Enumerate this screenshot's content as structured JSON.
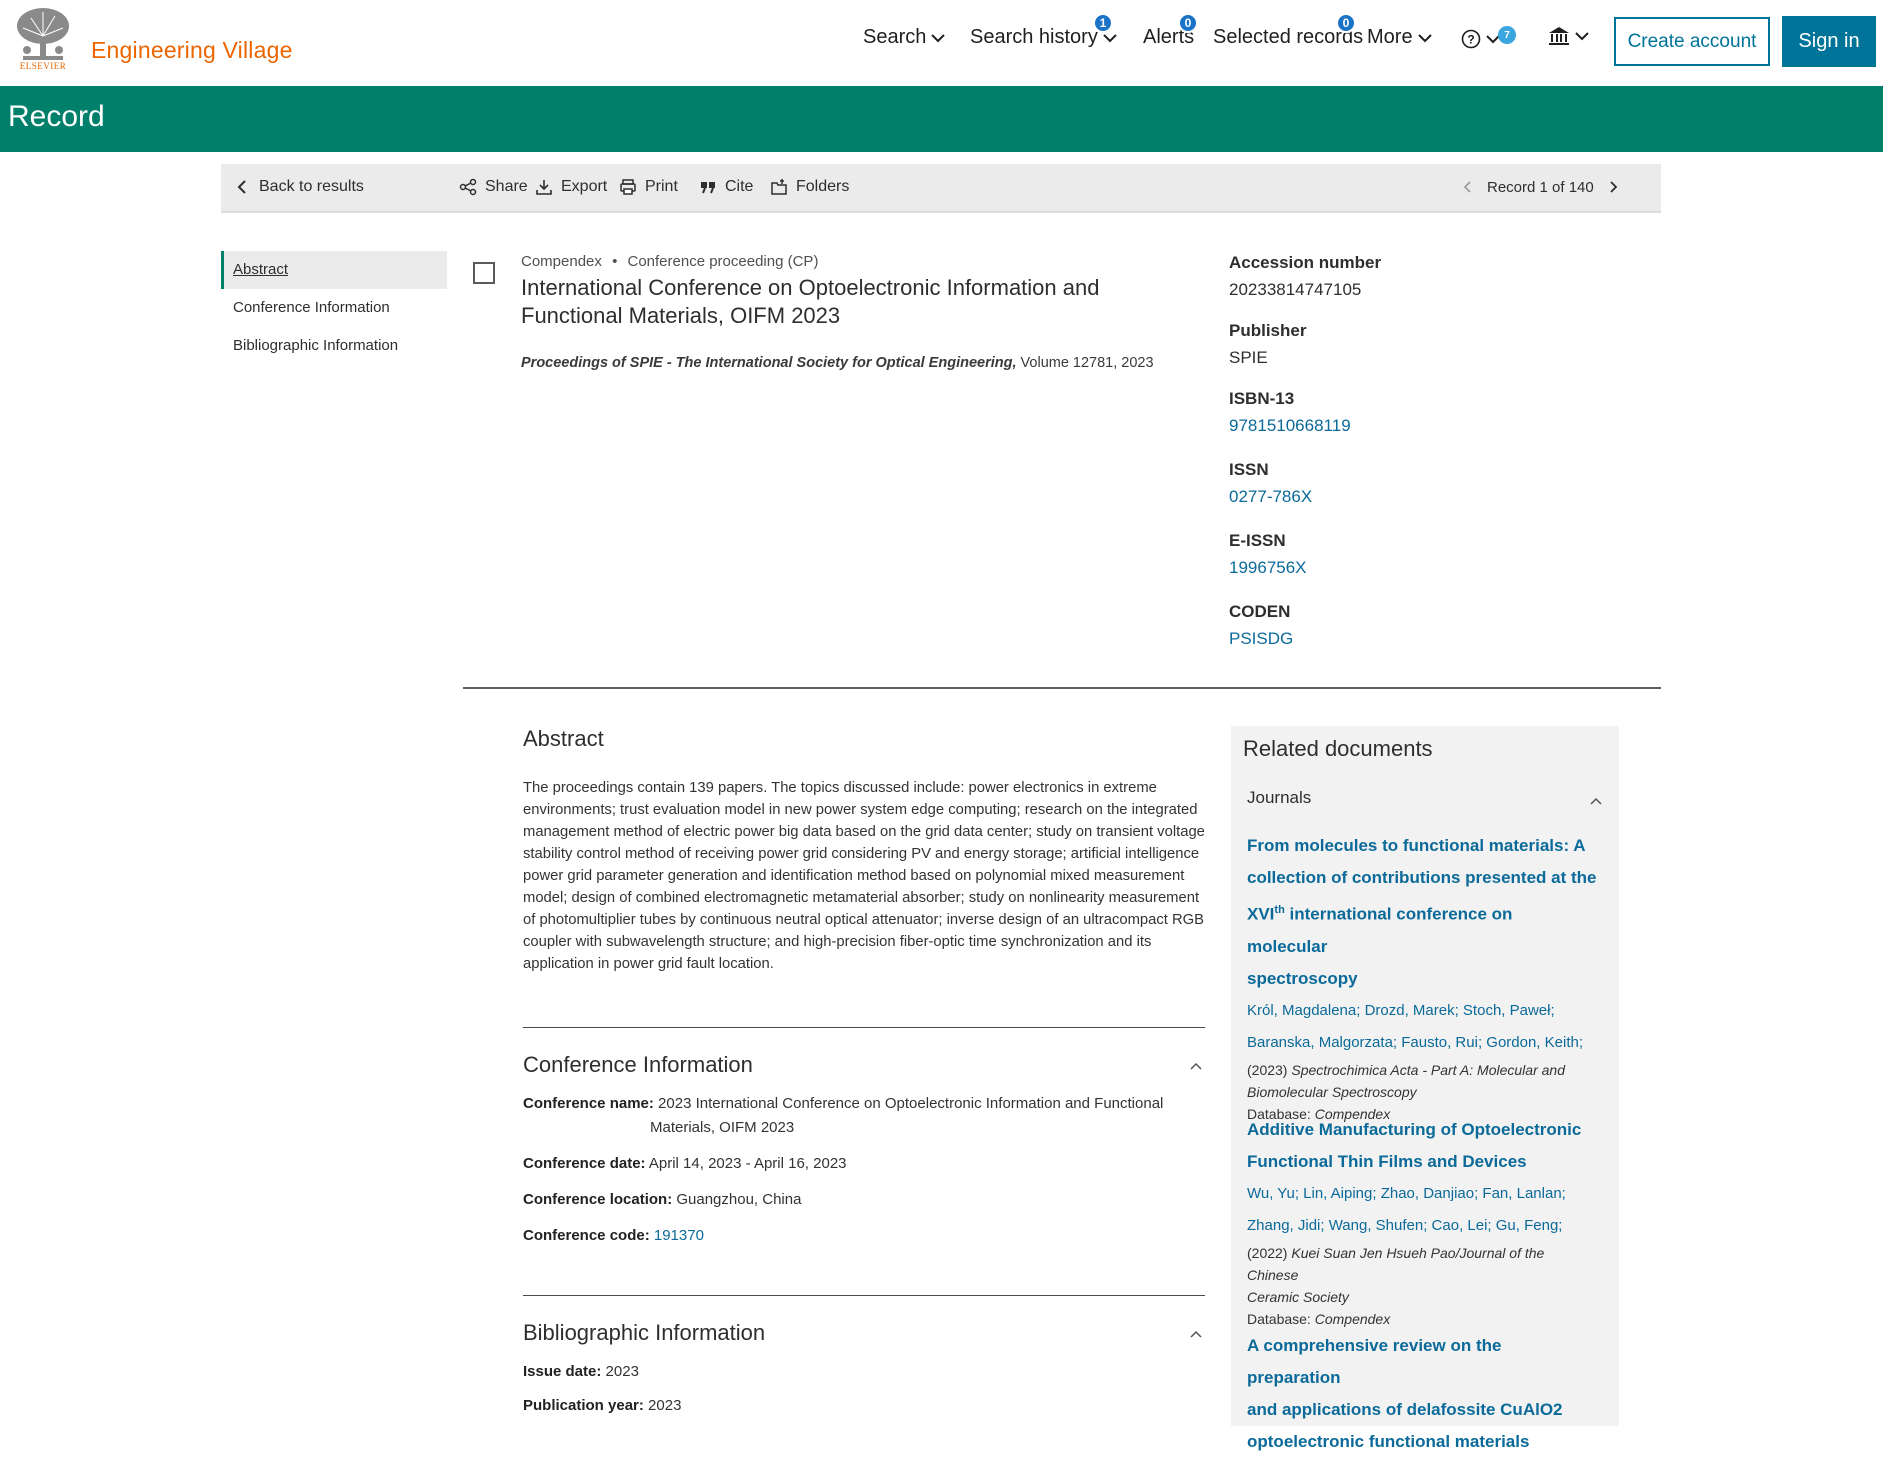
{
  "header": {
    "logo_text": "ELSEVIER",
    "brand": "Engineering Village",
    "nav": {
      "search": "Search",
      "search_history": "Search history",
      "search_history_badge": "1",
      "alerts": "Alerts",
      "alerts_badge": "0",
      "selected_records": "Selected records",
      "selected_records_badge": "0",
      "more": "More",
      "help_badge": "7"
    },
    "create_account": "Create account",
    "sign_in": "Sign in"
  },
  "banner": {
    "title": "Record"
  },
  "toolbar": {
    "back": "Back to results",
    "share": "Share",
    "export": "Export",
    "print": "Print",
    "cite": "Cite",
    "folders": "Folders",
    "record_pos": "Record 1 of 140"
  },
  "leftnav": [
    "Abstract",
    "Conference Information",
    "Bibliographic Information"
  ],
  "record": {
    "database": "Compendex",
    "doc_type": "Conference proceeding (CP)",
    "title": "International Conference on Optoelectronic Information and Functional Materials, OIFM 2023",
    "journal": "Proceedings of SPIE - The International Society for Optical Engineering,",
    "volume": "Volume 12781, 2023"
  },
  "meta": [
    {
      "label": "Accession number",
      "value": "20233814747105",
      "link": false
    },
    {
      "label": "Publisher",
      "value": "SPIE",
      "link": false
    },
    {
      "label": "ISBN-13",
      "value": "9781510668119",
      "link": true
    },
    {
      "label": "ISSN",
      "value": "0277-786X",
      "link": true
    },
    {
      "label": "E-ISSN",
      "value": "1996756X",
      "link": true
    },
    {
      "label": "CODEN",
      "value": "PSISDG",
      "link": true
    }
  ],
  "abstract": {
    "heading": "Abstract",
    "text": "The proceedings contain 139 papers. The topics discussed include: power electronics in extreme environments; trust evaluation model in new power system edge computing; research on the integrated management method of electric power big data based on the grid data center; study on transient voltage stability control method of receiving power grid considering PV and energy storage; artificial intelligence power grid parameter generation and identification method based on polynomial mixed measurement model; design of combined electromagnetic metamaterial absorber; study on nonlinearity measurement of photomultiplier tubes by continuous neutral optical attenuator; inverse design of an ultracompact RGB coupler with subwavelength structure; and high-precision fiber-optic time synchronization and its application in power grid fault location."
  },
  "conference": {
    "heading": "Conference Information",
    "name_label": "Conference name:",
    "name": "2023 International Conference on Optoelectronic Information and Functional",
    "name_cont": "Materials, OIFM 2023",
    "date_label": "Conference date:",
    "date": "April 14, 2023 - April 16, 2023",
    "location_label": "Conference location:",
    "location": "Guangzhou, China",
    "code_label": "Conference code:",
    "code": "191370"
  },
  "bibliographic": {
    "heading": "Bibliographic Information",
    "issue_label": "Issue date:",
    "issue": "2023",
    "pubyear_label": "Publication year:",
    "pubyear": "2023"
  },
  "related": {
    "title": "Related documents",
    "journals_label": "Journals",
    "docs": [
      {
        "title_l1": "From molecules to functional materials: A",
        "title_l2": "collection of contributions presented at the",
        "title_l3a": "XVI",
        "title_sup": "th",
        "title_l3b": " international conference on molecular",
        "title_l4": "spectroscopy",
        "authors_l1": "Król, Magdalena; Drozd, Marek; Stoch, Paweł;",
        "authors_l2": "Baranska, Malgorzata; Fausto, Rui; Gordon, Keith;",
        "year": "(2023)",
        "source_l1": "Spectrochimica Acta - Part A: Molecular and",
        "source_l2": "Biomolecular Spectroscopy",
        "db_label": "Database:",
        "db": "Compendex"
      },
      {
        "title_l1": "Additive Manufacturing of Optoelectronic",
        "title_l2": "Functional Thin Films and Devices",
        "authors_l1": "Wu, Yu;  Lin, Aiping; Zhao, Danjiao; Fan, Lanlan;",
        "authors_l2": "Zhang, Jidi; Wang, Shufen;  Cao, Lei;  Gu, Feng;",
        "year": "(2022)",
        "source_l1": "Kuei Suan Jen Hsueh Pao/Journal of the Chinese",
        "source_l2": "Ceramic Society",
        "db_label": "Database:",
        "db": "Compendex"
      },
      {
        "title_l1": "A comprehensive review on the preparation",
        "title_l2": "and applications of delafossite CuAlO2",
        "title_l3": "optoelectronic functional materials"
      }
    ]
  }
}
